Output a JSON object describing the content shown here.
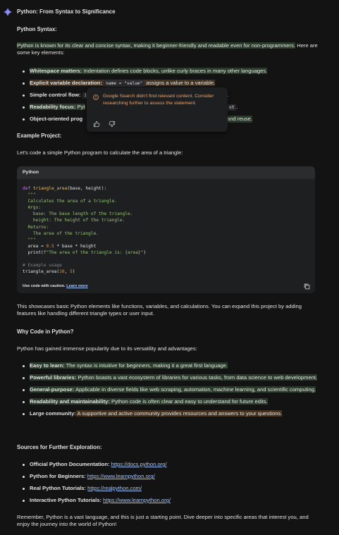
{
  "header": {
    "title": "Python: From Syntax to Significance",
    "icon": "gemini-spark-icon"
  },
  "sections": {
    "syntax_heading": "Python Syntax:",
    "intro": "Python is known for its clear and concise syntax, making it beginner-friendly and readable even for non-programmers. Here are some key elements:",
    "intro_part1": "Python is known for its clear and concise syntax, making it beginner-friendly and readable even for non-",
    "intro_part2": "programmers.",
    "intro_part3": " Here are some key elements:",
    "syntax_items": [
      {
        "label": "Whitespace matters:",
        "text": " Indentation defines code blocks, unlike curly braces in many other languages."
      },
      {
        "label": "Explicit variable declaration:",
        "code": "name = \"value\"",
        "text": " assigns a value to a variable."
      },
      {
        "label": "Simple control flow:",
        "code": "i",
        "text": "."
      },
      {
        "label": "Readability focus:",
        "text": "Pyt",
        "tail_code": "ot",
        "tail": "."
      },
      {
        "label": "Object-oriented prog",
        "text": "and reuse."
      }
    ],
    "example_heading": "Example Project:",
    "example_intro": "Let's code a simple Python program to calculate the area of a triangle:",
    "showcase": "This showcases basic Python elements like functions, variables, and calculations. You can expand this project by adding features like handling different triangle types or user input.",
    "why_heading": "Why Code in Python?",
    "why_intro": "Python has gained immense popularity due to its versatility and advantages:",
    "why_items": [
      {
        "label": "Easy to learn:",
        "text": " The syntax is intuitive for beginners, making it a great first language."
      },
      {
        "label": "Powerful libraries:",
        "text": " Python boasts a vast ecosystem of libraries for various tasks, from data science to web development."
      },
      {
        "label": "General-purpose:",
        "text": " Applicable in diverse fields like web scraping, automation, machine learning, and scientific computing."
      },
      {
        "label": "Readability and maintainability:",
        "text": " Python code is often clear and easy to understand for future edits."
      },
      {
        "label": "Large community:",
        "text": " A supportive and active community provides resources and answers to your questions."
      }
    ],
    "sources_heading": "Sources for Further Exploration:",
    "sources": [
      {
        "label": "Official Python Documentation:",
        "url": "https://docs.python.org/"
      },
      {
        "label": "Python for Beginners:",
        "url": "https://www.learnpython.org/"
      },
      {
        "label": "Real Python Tutorials:",
        "url": "https://realpython.com/"
      },
      {
        "label": "Interactive Python Tutorials:",
        "url": "https://www.learnpython.org/"
      }
    ],
    "closing": "Remember, Python is a vast language, and this is just a starting point. Dive deeper into specific areas that interest you, and enjoy the journey into the world of Python!"
  },
  "code_block": {
    "language": "Python",
    "lines": [
      "def triangle_area(base, height):",
      "  \"\"\"",
      "  Calculates the area of a triangle.",
      "  Args:",
      "    base: The base length of the triangle.",
      "    height: The height of the triangle.",
      "  Returns:",
      "    The area of the triangle.",
      "  \"\"\"",
      "  area = 0.5 * base * height",
      "  print(f\"The area of the triangle is: {area}\")",
      "",
      "# Example usage",
      "triangle_area(10, 5)"
    ],
    "caution": "Use code with caution.",
    "learn_more": "Learn more",
    "copy_icon": "copy-icon"
  },
  "tooltip": {
    "message": "Google Search didn't find relevant content. Consider researching further to assess the statement.",
    "warning_icon": "warning-circle-icon",
    "thumbs_up_icon": "thumbs-up-icon",
    "thumbs_down_icon": "thumbs-down-icon"
  },
  "colors": {
    "background": "#131314",
    "text": "#e3e3e3",
    "highlight_green": "#2b3b2b",
    "highlight_orange": "#43321f",
    "link": "#a8c7fa",
    "warning": "#f0a36b"
  }
}
